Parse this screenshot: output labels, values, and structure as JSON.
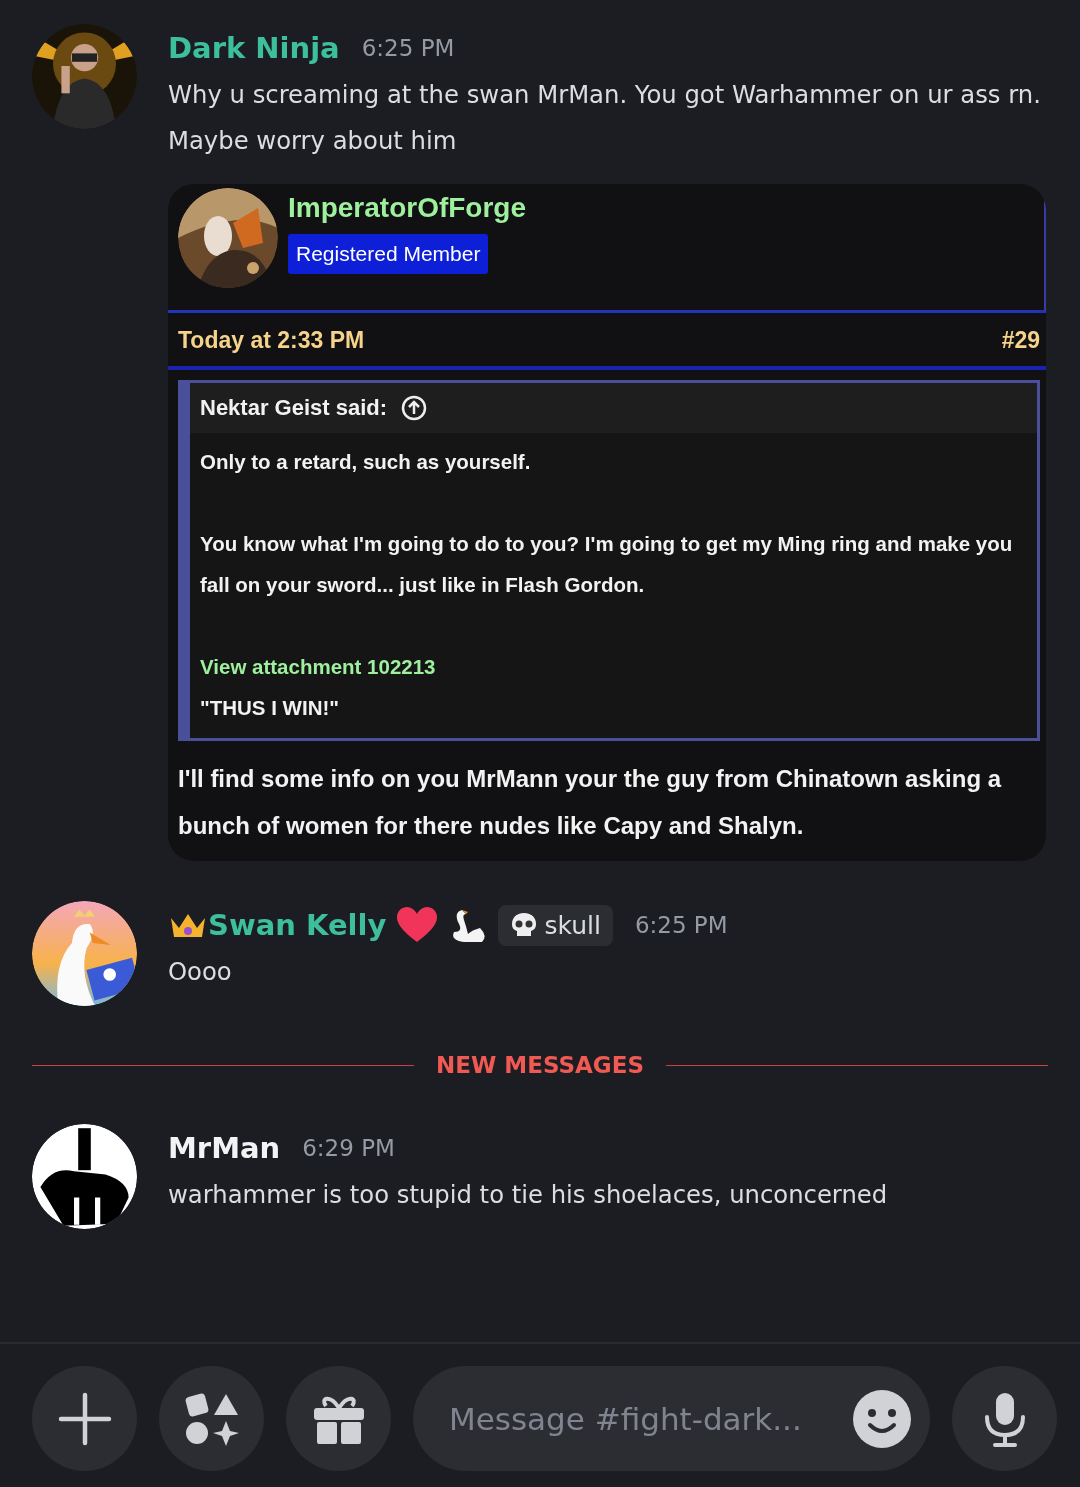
{
  "messages": [
    {
      "author": "Dark Ninja",
      "color": "#3dbf9b",
      "time": "6:25 PM",
      "text": "Why u screaming at the swan MrMan. You got Warhammer on ur ass rn. Maybe worry about him",
      "embed": {
        "author": "ImperatorOfForge",
        "badge": "Registered Member",
        "date": "Today at 2:33 PM",
        "post_number": "#29",
        "quote": {
          "author": "Nektar Geist said:",
          "paragraphs": [
            "Only to a retard, such as yourself.",
            "You know what I'm going to do to you? I'm going to get my Ming ring and make you fall on your sword... just like in Flash Gordon."
          ],
          "link": "View attachment 102213",
          "caption": "\"THUS I WIN!\""
        },
        "body": "I'll find some info on you MrMann your the guy from Chinatown asking a bunch of women for there nudes like Capy and Shalyn."
      }
    },
    {
      "author": "Swan Kelly",
      "color": "#3dbf9b",
      "time": "6:25 PM",
      "text": "Oooo",
      "decorated": true,
      "tag": "skull"
    }
  ],
  "divider": "NEW MESSAGES",
  "new_messages": [
    {
      "author": "MrMan",
      "color": "#f2f3f5",
      "time": "6:29 PM",
      "text": "warhammer is too stupid to tie his shoelaces, unconcerned"
    }
  ],
  "composer": {
    "placeholder": "Message #fight-dark..."
  }
}
